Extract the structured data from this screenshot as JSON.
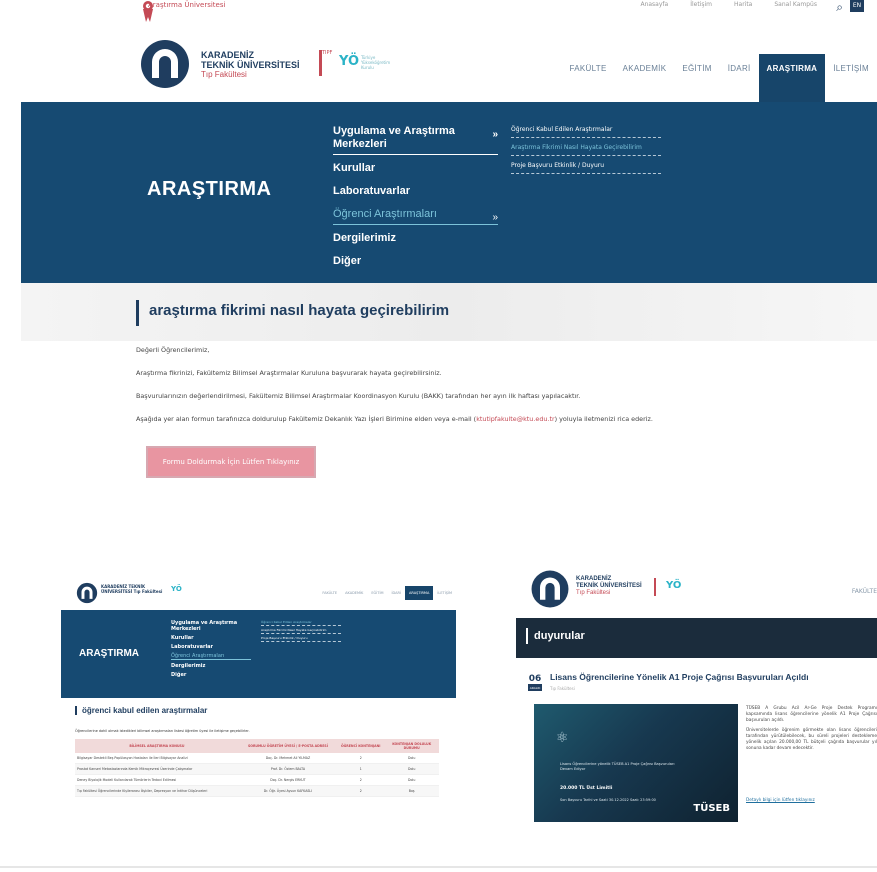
{
  "top_bar": {
    "brand_tag": "Araştırma Üniversitesi",
    "links": [
      "Anasayfa",
      "İletişim",
      "Harita",
      "Sanal Kampüs"
    ],
    "lang": "EN"
  },
  "logo": {
    "line1": "KARADENİZ",
    "line2": "TEKNİK ÜNİVERSİTESİ",
    "line3": "Tıp Fakültesi",
    "tipf": "TIPF",
    "yok": "YÖ",
    "yok_sub": "Türkiye Yükseköğretim Kurulu"
  },
  "nav": {
    "items": [
      "FAKÜLTE",
      "AKADEMİK",
      "EĞİTİM",
      "İDARİ",
      "ARAŞTIRMA",
      "İLETİŞİM"
    ],
    "active": "ARAŞTIRMA"
  },
  "hero": {
    "title": "ARAŞTIRMA",
    "menu": [
      {
        "label": "Uygulama ve Araştırma Merkezleri",
        "chev": "»"
      },
      {
        "label": "Kurullar"
      },
      {
        "label": "Laboratuvarlar"
      },
      {
        "label": "Öğrenci Araştırmaları",
        "chev": "»"
      },
      {
        "label": "Dergilerimiz"
      },
      {
        "label": "Diğer"
      }
    ],
    "submenu": [
      "Öğrenci Kabul Edilen Araştırmalar",
      "Araştırma Fikrimi Nasıl Hayata Geçirebilirim",
      "Proje Başvuru Etkinlik / Duyuru"
    ]
  },
  "page": {
    "title": "araştırma fikrimi nasıl hayata geçirebilirim",
    "p1": "Değerli Öğrencilerimiz,",
    "p2": "Araştırma fikrinizi, Fakültemiz Bilimsel Araştırmalar Kuruluna başvurarak hayata geçirebilirsiniz.",
    "p3": "Başvurularınızın değerlendirilmesi, Fakültemiz Bilimsel Araştırmalar Koordinasyon Kurulu (BAKK) tarafından her ayın ilk haftası yapılacaktır.",
    "p4_a": "Aşağıda yer alan formun tarafınızca doldurulup Fakültemiz Dekanlık Yazı İşleri Birimine elden veya e-mail (",
    "p4_mail": "ktutipfakulte@ktu.edu.tr",
    "p4_b": ") yoluyla iletmenizi rica ederiz.",
    "form_button": "Formu Doldurmak İçin Lütfen Tıklayınız"
  },
  "thumb_left": {
    "logo": "KARADENİZ TEKNİK ÜNİVERSİTESİ Tıp Fakültesi",
    "yok": "YÖ",
    "nav": [
      "FAKÜLTE",
      "AKADEMİK",
      "EĞİTİM",
      "İDARİ",
      "ARAŞTIRMA",
      "İLETİŞİM"
    ],
    "hero_title": "ARAŞTIRMA",
    "menu": [
      "Uygulama ve Araştırma Merkezleri",
      "Kurullar",
      "Laboratuvarlar",
      "Öğrenci Araştırmaları",
      "Dergilerimiz",
      "Diğer"
    ],
    "submenu": [
      "Öğrenci Kabul Edilen Araştırmalar",
      "Araştırma Fikrimi Nasıl Hayata Geçirebilirim",
      "Proje Başvuru Etkinlik / Duyuru"
    ],
    "title": "öğrenci kabul edilen araştırmalar",
    "intro": "Öğrencilerine dahil olmak istedikleri bilimsel araştırmaları listesi öğretim üyesi ile iletişime geçebilirler.",
    "headers": [
      "BİLİMSEL ARAŞTIRMA KONUSU",
      "SORUMLU ÖĞRETİM ÜYESİ / E-POSTA ADRESİ",
      "ÖĞRENCİ KONTENJANI",
      "KONTENJAN DOLULUK DURUMU"
    ],
    "rows": [
      [
        "Bilgisayar Destekli Beş Popülasyon Hastaları ile İleri Bilgisayar Analizi",
        "Doç. Dr. Mehmet Ali YILMAZ",
        "2",
        "Dolu"
      ],
      [
        "Prostat Kanseri Metastazlarında Kemik Mikroçevresi Üzerinde Çalışmalar",
        "Prof. Dr. Özlem BALTA",
        "1",
        "Dolu"
      ],
      [
        "Deney Biyolojik Modeli Kullanılarak Tümörlerin Tedavi Edilmesi",
        "Doç. Dr. Nergis ERKUT",
        "2",
        "Dolu"
      ],
      [
        "Tıp Fakültesi Öğrencilerinde Kişilerarası İlişkiler, Depresyon ve İntihar Düşünceleri",
        "Dr. Öğr. Üyesi Aysun KAFKASLI",
        "2",
        "Boş"
      ]
    ]
  },
  "thumb_right": {
    "logo_l1": "KARADENİZ",
    "logo_l2": "TEKNİK ÜNİVERSİTESİ",
    "logo_l3": "Tıp Fakültesi",
    "yok": "YÖ",
    "nav_item": "FAKÜLTE",
    "band_title": "duyurular",
    "date_day": "06",
    "date_month": "ARALIK",
    "news_title": "Lisans Öğrencilerine Yönelik A1 Proje Çağrısı Başvuruları Açıldı",
    "news_sub": "Tıp Fakültesi",
    "img_text": "Lisans Öğrencilerine yönelik TÜSEB A1 Proje Çağrısı Başvuruları Devam Ediyor",
    "img_amount": "20.000 TL Üst Limitli",
    "img_deadline": "Son Başvuru Tarihi ve Saati 30.12.2022 Saat: 23:59:00",
    "img_logo": "TÜSEB",
    "body_p1": "TÜSEB A Grubu Acil Ar-Ge Proje Destek Programı kapsamında lisans öğrencilerine yönelik A1 Proje Çağrısı başvuruları açıldı.",
    "body_p2": "Üniversitelerde öğrenim görmekte olan lisans öğrencileri tarafından yürütülebilecek, bu süreli projeleri destekleme yönelik açılan 20.000,00 TL bütçeli çağrıda başvurular yıl sonuna kadar devam edecektir.",
    "more_link": "Detaylı bilgi için lütfen tıklayınız"
  }
}
